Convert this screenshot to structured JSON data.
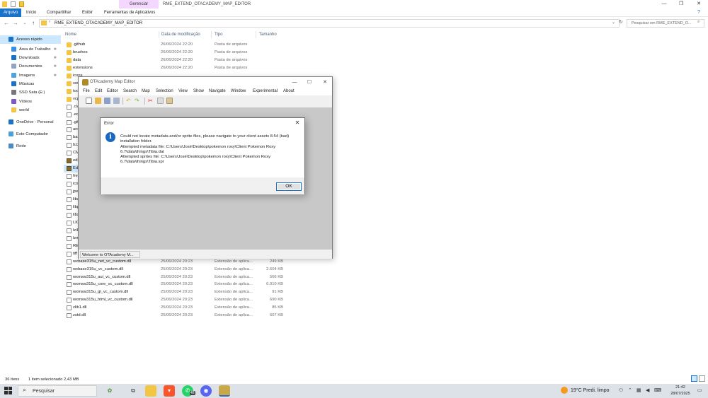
{
  "explorer": {
    "context_tab": "Gerenciar",
    "window_title": "RME_EXTEND_OTACADEMY_MAP_EDITOR",
    "ribbon_tabs": [
      "Arquivo",
      "Início",
      "Compartilhar",
      "Exibir",
      "Ferramentas de Aplicativos"
    ],
    "address": "RME_EXTEND_OTACADEMY_MAP_EDITOR",
    "search_placeholder": "Pesquisar em RME_EXTEND_O...",
    "columns": {
      "name": "Nome",
      "date": "Data de modificação",
      "type": "Tipo",
      "size": "Tamanho"
    },
    "sidebar": [
      {
        "label": "Acesso rápido",
        "icon": "star-icon",
        "pin": false
      },
      {
        "label": "Área de Trabalho",
        "icon": "desktop-icon",
        "pin": true
      },
      {
        "label": "Downloads",
        "icon": "download-icon",
        "pin": true
      },
      {
        "label": "Documentos",
        "icon": "documents-icon",
        "pin": true
      },
      {
        "label": "Imagens",
        "icon": "pictures-icon",
        "pin": true
      },
      {
        "label": "Músicas",
        "icon": "music-icon",
        "pin": false
      },
      {
        "label": "SSD Sata (E:)",
        "icon": "drive-icon",
        "pin": false
      },
      {
        "label": "Vídeos",
        "icon": "video-icon",
        "pin": false
      },
      {
        "label": "world",
        "icon": "folder-icon",
        "pin": false
      },
      {
        "label": "OneDrive - Personal",
        "icon": "cloud-icon",
        "pin": false
      },
      {
        "label": "Este Computador",
        "icon": "computer-icon",
        "pin": false
      },
      {
        "label": "Rede",
        "icon": "network-icon",
        "pin": false
      }
    ],
    "pin_glyph": "✱",
    "files": [
      {
        "name": ".github",
        "date": "26/06/2024 22:20",
        "type": "Pasta de arquivos",
        "size": "",
        "kind": "folder"
      },
      {
        "name": "brushes",
        "date": "26/06/2024 22:20",
        "type": "Pasta de arquivos",
        "size": "",
        "kind": "folder"
      },
      {
        "name": "data",
        "date": "26/06/2024 22:20",
        "type": "Pasta de arquivos",
        "size": "",
        "kind": "folder"
      },
      {
        "name": "extensions",
        "date": "26/06/2024 22:20",
        "type": "Pasta de arquivos",
        "size": "",
        "kind": "folder"
      },
      {
        "name": "icons",
        "date": "",
        "type": "",
        "size": "",
        "kind": "folder"
      },
      {
        "name": "sou",
        "date": "",
        "type": "",
        "size": "",
        "kind": "folder"
      },
      {
        "name": "too",
        "date": "",
        "type": "",
        "size": "",
        "kind": "folder"
      },
      {
        "name": "vcp",
        "date": "",
        "type": "",
        "size": "",
        "kind": "folder"
      },
      {
        "name": ".cla",
        "date": "",
        "type": "",
        "size": "",
        "kind": "file"
      },
      {
        "name": ".edi",
        "date": "",
        "type": "",
        "size": "",
        "kind": "file"
      },
      {
        "name": ".git",
        "date": "",
        "type": "",
        "size": "",
        "kind": "file"
      },
      {
        "name": "arch",
        "date": "",
        "type": "",
        "size": "",
        "kind": "file"
      },
      {
        "name": "bas",
        "date": "",
        "type": "",
        "size": "",
        "kind": "file"
      },
      {
        "name": "bz2",
        "date": "",
        "type": "",
        "size": "",
        "kind": "file"
      },
      {
        "name": "CM",
        "date": "",
        "type": "",
        "size": "",
        "kind": "file"
      },
      {
        "name": "edit",
        "date": "",
        "type": "",
        "size": "",
        "kind": "app"
      },
      {
        "name": "Edit",
        "date": "",
        "type": "",
        "size": "",
        "kind": "app"
      },
      {
        "name": "free",
        "date": "",
        "type": "",
        "size": "",
        "kind": "file"
      },
      {
        "name": "icon",
        "date": "",
        "type": "",
        "size": "",
        "kind": "file"
      },
      {
        "name": "jpe",
        "date": "",
        "type": "",
        "size": "",
        "kind": "file"
      },
      {
        "name": "liba",
        "date": "",
        "type": "",
        "size": "",
        "kind": "file"
      },
      {
        "name": "libp",
        "date": "",
        "type": "",
        "size": "",
        "kind": "file"
      },
      {
        "name": "libx",
        "date": "",
        "type": "",
        "size": "",
        "kind": "file"
      },
      {
        "name": "LIC",
        "date": "",
        "type": "",
        "size": "",
        "kind": "file"
      },
      {
        "name": "lz4",
        "date": "",
        "type": "",
        "size": "",
        "kind": "file"
      },
      {
        "name": "lzm",
        "date": "",
        "type": "",
        "size": "",
        "kind": "file"
      },
      {
        "name": "REA",
        "date": "",
        "type": "",
        "size": "",
        "kind": "file"
      },
      {
        "name": "tiff",
        "date": "",
        "type": "",
        "size": "",
        "kind": "file"
      },
      {
        "name": "wxbase315u_net_vc_custom.dll",
        "date": "25/06/2024 20:23",
        "type": "Extensão de aplica...",
        "size": "249 KB",
        "kind": "file"
      },
      {
        "name": "wxbase315u_vc_custom.dll",
        "date": "25/06/2024 20:23",
        "type": "Extensão de aplica...",
        "size": "2.604 KB",
        "kind": "file"
      },
      {
        "name": "wxmsw315u_aui_vc_custom.dll",
        "date": "25/06/2024 20:23",
        "type": "Extensão de aplica...",
        "size": "566 KB",
        "kind": "file"
      },
      {
        "name": "wxmsw315u_core_vc_custom.dll",
        "date": "25/06/2024 20:23",
        "type": "Extensão de aplica...",
        "size": "6.010 KB",
        "kind": "file"
      },
      {
        "name": "wxmsw315u_gl_vc_custom.dll",
        "date": "25/06/2024 20:23",
        "type": "Extensão de aplica...",
        "size": "91 KB",
        "kind": "file"
      },
      {
        "name": "wxmsw315u_html_vc_custom.dll",
        "date": "25/06/2024 20:23",
        "type": "Extensão de aplica...",
        "size": "690 KB",
        "kind": "file"
      },
      {
        "name": "zlib1.dll",
        "date": "25/06/2024 20:23",
        "type": "Extensão de aplica...",
        "size": "85 KB",
        "kind": "file"
      },
      {
        "name": "zstd.dll",
        "date": "25/06/2024 20:23",
        "type": "Extensão de aplica...",
        "size": "607 KB",
        "kind": "file"
      }
    ],
    "selected_index": 16,
    "status_items": "36 itens",
    "status_selected": "1 item selecionado  2,43 MB"
  },
  "editor": {
    "title": "OTAcademy Map Editor",
    "menu": [
      "File",
      "Edit",
      "Editor",
      "Search",
      "Map",
      "Selection",
      "View",
      "Show",
      "Navigate",
      "Window",
      "Experimental",
      "About"
    ],
    "status_text": "Welcome to OTAcademy M..."
  },
  "dialog": {
    "title": "Error",
    "icon_glyph": "i",
    "line1": "Could not locate metadata and/or sprite files, please navigate to your client assets 8.54 (bad)",
    "line2": "installation folder.",
    "line3": "Attempted metadata file: C:\\Users\\José\\Desktop\\pokemon roxy\\Client Pokemon Roxy",
    "line4": "6.7\\data\\things\\Tibia.dat",
    "line5": "Attempted sprites file: C:\\Users\\José\\Desktop\\pokemon roxy\\Client Pokemon Roxy",
    "line6": "6.7\\data\\things\\Tibia.spr",
    "ok_label": "OK",
    "close_glyph": "✕"
  },
  "taskbar": {
    "search_label": "Pesquisar",
    "weather": "19°C  Predi. limpo",
    "time": "21:42",
    "date": "28/07/2025",
    "badge": "48",
    "apps": [
      "plant-widget-icon",
      "task-view-icon",
      "file-explorer-icon",
      "brave-browser-icon",
      "whatsapp-icon",
      "discord-icon",
      "map-editor-icon"
    ]
  },
  "colors": {
    "accent": "#1a73c9",
    "selection": "#cce8ff",
    "folder": "#f4c542",
    "context_tab": "#f4d7ff",
    "info_icon": "#1968c6"
  }
}
